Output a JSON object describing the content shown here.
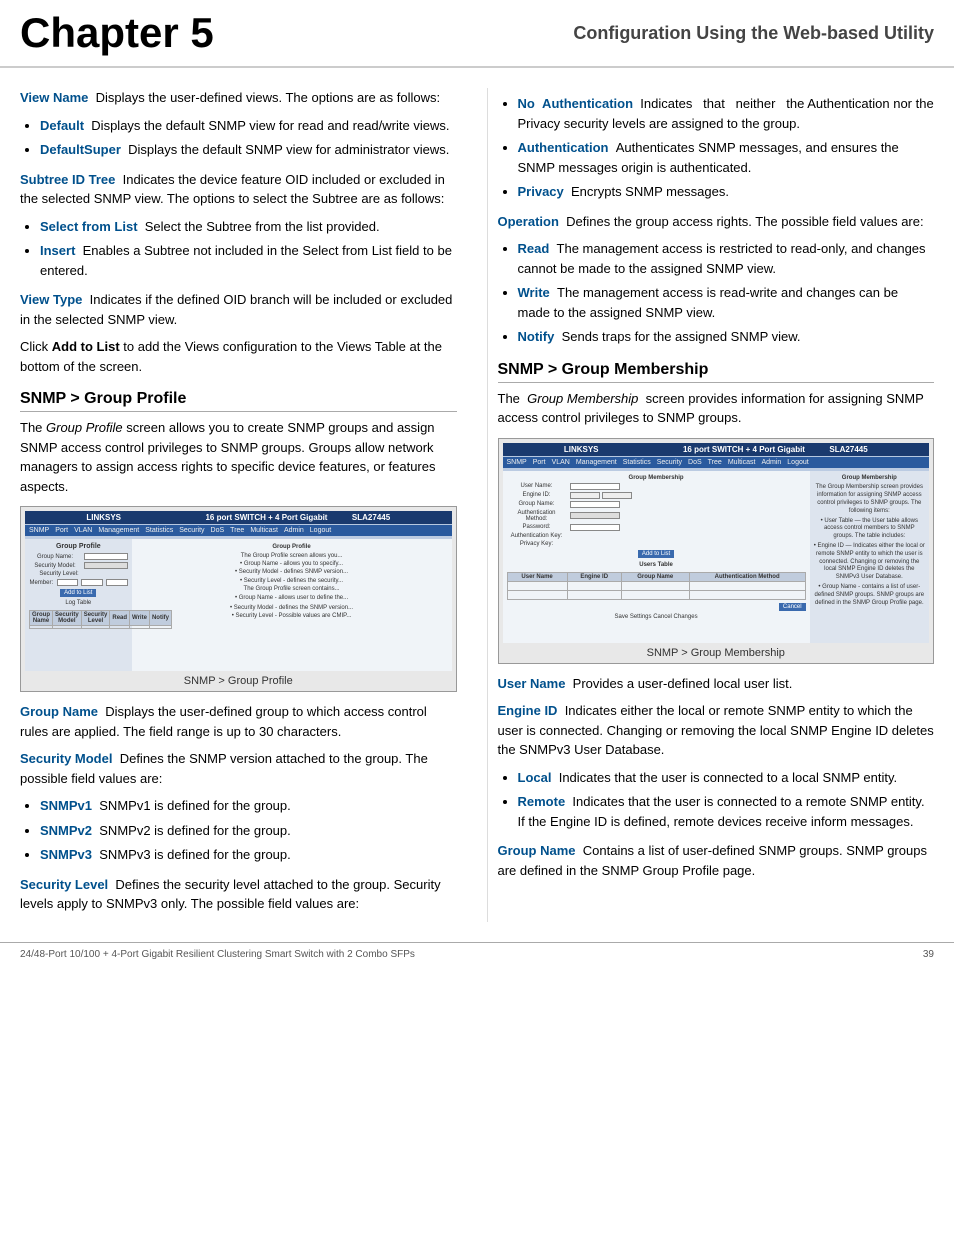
{
  "header": {
    "chapter": "Chapter 5",
    "subtitle": "Configuration Using the Web-based Utility"
  },
  "footer": {
    "left": "24/48-Port 10/100 + 4-Port Gigabit Resilient Clustering Smart Switch with 2 Combo SFPs",
    "right": "39"
  },
  "left_col": {
    "view_name_label": "View Name",
    "view_name_text": "Displays the user-defined views. The options are as follows:",
    "bullets_view": [
      {
        "label": "Default",
        "text": "Displays the default SNMP view for read and read/write views."
      },
      {
        "label": "DefaultSuper",
        "text": "Displays the default SNMP view for administrator views."
      }
    ],
    "subtree_label": "Subtree ID Tree",
    "subtree_text": "Indicates the device feature OID included or excluded in the selected SNMP view. The options to select the Subtree are as follows:",
    "bullets_subtree": [
      {
        "label": "Select from List",
        "text": "Select the Subtree from the list provided."
      },
      {
        "label": "Insert",
        "text": "Enables a Subtree not included in the Select from List field to be entered."
      }
    ],
    "view_type_label": "View Type",
    "view_type_text": "Indicates if the defined OID branch will be included or excluded in the selected SNMP view.",
    "add_list_text": "Click Add to List to add the Views configuration to the Views Table at the bottom of the screen.",
    "section1_heading": "SNMP > Group Profile",
    "section1_intro": "The Group Profile screen allows you to create SNMP groups and assign SNMP access control privileges to SNMP groups. Groups allow network managers to assign access rights to specific device features, or features aspects.",
    "screenshot1_caption": "SNMP >  Group Profile",
    "group_name_label": "Group Name",
    "group_name_text": "Displays the user-defined group to which access control rules are applied. The field range is up to 30 characters.",
    "security_model_label": "Security Model",
    "security_model_text": "Defines the SNMP version attached to the group. The possible field values are:",
    "bullets_security": [
      {
        "label": "SNMPv1",
        "text": "SNMPv1 is defined for the group."
      },
      {
        "label": "SNMPv2",
        "text": "SNMPv2 is defined for the group."
      },
      {
        "label": "SNMPv3",
        "text": "SNMPv3 is defined for the group."
      }
    ],
    "security_level_label": "Security Level",
    "security_level_text": "Defines the security level attached to the group. Security levels apply to SNMPv3 only. The possible field values are:"
  },
  "right_col": {
    "bullets_security_level": [
      {
        "label": "No  Authentication",
        "text": "Indicates   that   neither   the Authentication nor the Privacy security levels are assigned to the group."
      },
      {
        "label": "Authentication",
        "text": "Authenticates SNMP messages, and ensures the SNMP messages origin is authenticated."
      },
      {
        "label": "Privacy",
        "text": "Encrypts SNMP messages."
      }
    ],
    "operation_label": "Operation",
    "operation_text": "Defines the group access rights. The possible field values are:",
    "bullets_operation": [
      {
        "label": "Read",
        "text": "The management access is restricted to read-only, and changes cannot be made to the assigned SNMP view."
      },
      {
        "label": "Write",
        "text": "The management access is read-write and changes can be made to the assigned SNMP view."
      },
      {
        "label": "Notify",
        "text": "Sends traps for the assigned SNMP view."
      }
    ],
    "section2_heading": "SNMP > Group Membership",
    "section2_intro": "The  Group Membership  screen provides information for assigning SNMP access control privileges to SNMP groups.",
    "screenshot2_caption": "SNMP >  Group Membership",
    "user_name_label": "User Name",
    "user_name_text": "Provides a user-defined local user list.",
    "engine_id_label": "Engine ID",
    "engine_id_text": "Indicates either the local or remote SNMP entity to which the user is connected. Changing or removing the local SNMP Engine ID deletes the SNMPv3 User Database.",
    "bullets_engine": [
      {
        "label": "Local",
        "text": "Indicates that the user is connected to a local SNMP entity."
      },
      {
        "label": "Remote",
        "text": "Indicates that the user is connected to a remote SNMP entity. If the Engine ID is defined, remote devices receive inform messages."
      }
    ],
    "group_name2_label": "Group Name",
    "group_name2_text": "Contains a list of user-defined SNMP groups. SNMP groups are defined in the SNMP Group Profile page."
  }
}
